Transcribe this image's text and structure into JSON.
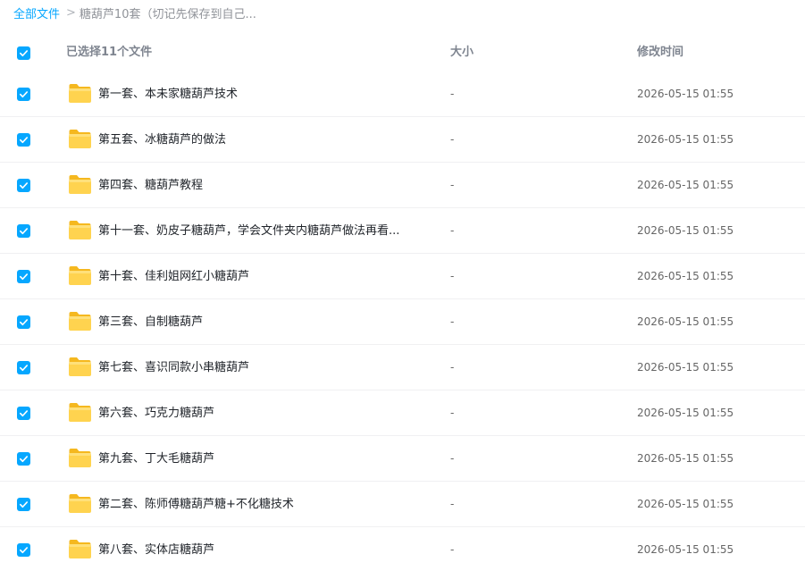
{
  "breadcrumb": {
    "root": "全部文件",
    "separator": ">",
    "current": "糖葫芦10套（切记先保存到自己..."
  },
  "header": {
    "selection_label": "已选择11个文件",
    "size_label": "大小",
    "time_label": "修改时间",
    "all_selected": true
  },
  "files": [
    {
      "name": "第一套、本未家糖葫芦技术",
      "size": "-",
      "time": "2026-05-15 01:55",
      "selected": true
    },
    {
      "name": "第五套、冰糖葫芦的做法",
      "size": "-",
      "time": "2026-05-15 01:55",
      "selected": true
    },
    {
      "name": "第四套、糖葫芦教程",
      "size": "-",
      "time": "2026-05-15 01:55",
      "selected": true
    },
    {
      "name": "第十一套、奶皮子糖葫芦，学会文件夹内糖葫芦做法再看...",
      "size": "-",
      "time": "2026-05-15 01:55",
      "selected": true
    },
    {
      "name": "第十套、佳利姐网红小糖葫芦",
      "size": "-",
      "time": "2026-05-15 01:55",
      "selected": true
    },
    {
      "name": "第三套、自制糖葫芦",
      "size": "-",
      "time": "2026-05-15 01:55",
      "selected": true
    },
    {
      "name": "第七套、喜识同款小串糖葫芦",
      "size": "-",
      "time": "2026-05-15 01:55",
      "selected": true
    },
    {
      "name": "第六套、巧克力糖葫芦",
      "size": "-",
      "time": "2026-05-15 01:55",
      "selected": true
    },
    {
      "name": "第九套、丁大毛糖葫芦",
      "size": "-",
      "time": "2026-05-15 01:55",
      "selected": true
    },
    {
      "name": "第二套、陈师傅糖葫芦糖+不化糖技术",
      "size": "-",
      "time": "2026-05-15 01:55",
      "selected": true
    },
    {
      "name": "第八套、实体店糖葫芦",
      "size": "-",
      "time": "2026-05-15 01:55",
      "selected": true
    }
  ],
  "icons": {
    "checkbox": "checkbox-checked-icon",
    "folder": "folder-icon",
    "breadcrumb_separator": "chevron-right-icon"
  },
  "colors": {
    "accent": "#06a7ff",
    "folder": "#ffd34f"
  }
}
